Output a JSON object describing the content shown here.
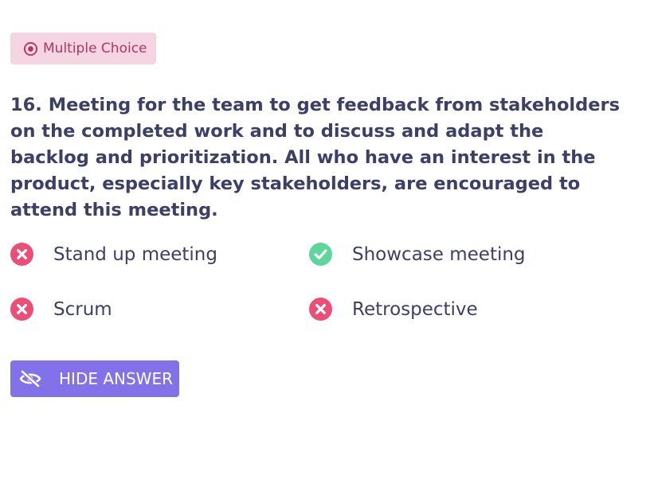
{
  "badge": {
    "icon": "radio-button-icon",
    "label": "Multiple Choice"
  },
  "question": {
    "text": "16. Meeting for the team to get feedback from stakeholders on the completed work and to discuss and adapt the backlog and prioritization. All who have an interest in the product, especially key stakeholders, are encouraged to attend this meeting."
  },
  "options": [
    {
      "label": "Stand up meeting",
      "correct": false,
      "icon": "cross-circle-icon"
    },
    {
      "label": "Showcase meeting",
      "correct": true,
      "icon": "check-circle-icon"
    },
    {
      "label": "Scrum",
      "correct": false,
      "icon": "cross-circle-icon"
    },
    {
      "label": "Retrospective",
      "correct": false,
      "icon": "cross-circle-icon"
    }
  ],
  "button": {
    "icon": "eye-slash-icon",
    "label": "HIDE ANSWER"
  },
  "colors": {
    "badge_bg": "#f6d5e2",
    "badge_text": "#b3365f",
    "text": "#3c3f66",
    "wrong": "#ee4d76",
    "correct": "#5ed69b",
    "button_bg": "#8272ea"
  }
}
